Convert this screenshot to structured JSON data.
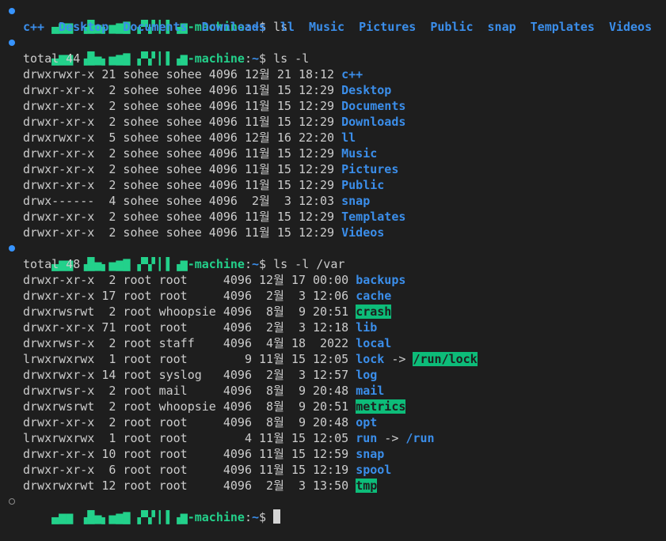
{
  "prompt": {
    "user_host": "▄▆▆ ▗█▅▖▅▆▇ ▞▚▘▎▌▗▆-machine",
    "sep": ":",
    "cwd": "~",
    "sigil": "$ "
  },
  "commands": [
    "ls",
    "ls -l",
    "ls -l /var"
  ],
  "ls_output": [
    "c++",
    "Desktop",
    "Documents",
    "Downloads",
    "ll",
    "Music",
    "Pictures",
    "Public",
    "snap",
    "Templates",
    "Videos"
  ],
  "home_listing": {
    "total": "total 44",
    "rows": [
      {
        "meta": "drwxrwxr-x 21 sohee sohee 4096 12월 21 18:12 ",
        "name": "c++"
      },
      {
        "meta": "drwxr-xr-x  2 sohee sohee 4096 11월 15 12:29 ",
        "name": "Desktop"
      },
      {
        "meta": "drwxr-xr-x  2 sohee sohee 4096 11월 15 12:29 ",
        "name": "Documents"
      },
      {
        "meta": "drwxr-xr-x  2 sohee sohee 4096 11월 15 12:29 ",
        "name": "Downloads"
      },
      {
        "meta": "drwxrwxr-x  5 sohee sohee 4096 12월 16 22:20 ",
        "name": "ll"
      },
      {
        "meta": "drwxr-xr-x  2 sohee sohee 4096 11월 15 12:29 ",
        "name": "Music"
      },
      {
        "meta": "drwxr-xr-x  2 sohee sohee 4096 11월 15 12:29 ",
        "name": "Pictures"
      },
      {
        "meta": "drwxr-xr-x  2 sohee sohee 4096 11월 15 12:29 ",
        "name": "Public"
      },
      {
        "meta": "drwx------  4 sohee sohee 4096  2월  3 12:03 ",
        "name": "snap"
      },
      {
        "meta": "drwxr-xr-x  2 sohee sohee 4096 11월 15 12:29 ",
        "name": "Templates"
      },
      {
        "meta": "drwxr-xr-x  2 sohee sohee 4096 11월 15 12:29 ",
        "name": "Videos"
      }
    ]
  },
  "var_listing": {
    "total": "total 48",
    "rows": [
      {
        "meta": "drwxr-xr-x  2 root root     4096 12월 17 00:00 ",
        "name": "backups"
      },
      {
        "meta": "drwxr-xr-x 17 root root     4096  2월  3 12:06 ",
        "name": "cache"
      },
      {
        "meta": "drwxrwsrwt  2 root whoopsie 4096  8월  9 20:51 ",
        "name": "crash",
        "highlight": true
      },
      {
        "meta": "drwxr-xr-x 71 root root     4096  2월  3 12:18 ",
        "name": "lib"
      },
      {
        "meta": "drwxrwsr-x  2 root staff    4096  4월 18  2022 ",
        "name": "local"
      },
      {
        "meta": "lrwxrwxrwx  1 root root        9 11월 15 12:05 ",
        "name": "lock",
        "arrow": " -> ",
        "target": "/run/lock",
        "target_highlight": true
      },
      {
        "meta": "drwxrwxr-x 14 root syslog   4096  2월  3 12:57 ",
        "name": "log"
      },
      {
        "meta": "drwxrwsr-x  2 root mail     4096  8월  9 20:48 ",
        "name": "mail"
      },
      {
        "meta": "drwxrwsrwt  2 root whoopsie 4096  8월  9 20:51 ",
        "name": "metrics",
        "highlight": true
      },
      {
        "meta": "drwxr-xr-x  2 root root     4096  8월  9 20:48 ",
        "name": "opt"
      },
      {
        "meta": "lrwxrwxrwx  1 root root        4 11월 15 12:05 ",
        "name": "run",
        "arrow": " -> ",
        "target": "/run"
      },
      {
        "meta": "drwxr-xr-x 10 root root     4096 11월 15 12:59 ",
        "name": "snap"
      },
      {
        "meta": "drwxr-xr-x  6 root root     4096 11월 15 12:19 ",
        "name": "spool"
      },
      {
        "meta": "drwxrwxrwt 12 root root     4096  2월  3 13:50 ",
        "name": "tmp",
        "highlight": true
      }
    ]
  }
}
